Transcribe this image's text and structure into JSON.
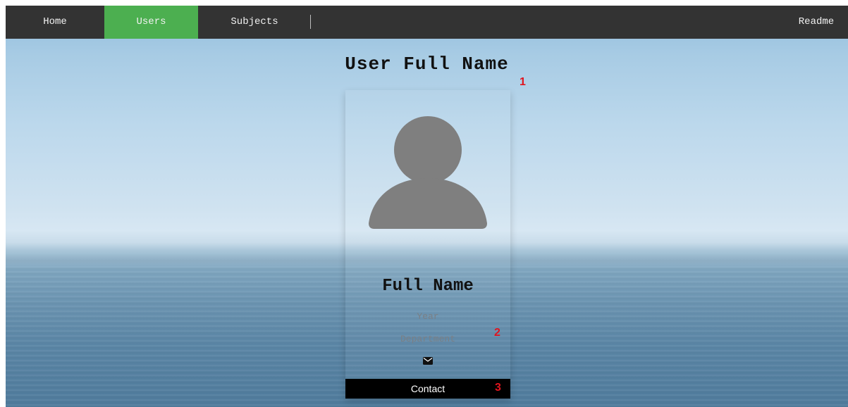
{
  "nav": {
    "home": "Home",
    "users": "Users",
    "subjects": "Subjects",
    "readme": "Readme",
    "active_color": "#4caf50",
    "bar_color": "#333333"
  },
  "page": {
    "title": "User Full Name"
  },
  "card": {
    "avatar_icon": "user-avatar-icon",
    "name": "Full Name",
    "year": "Year",
    "department": "Department",
    "mail_icon": "envelope-icon",
    "contact_label": "Contact"
  },
  "annotations": {
    "marker_1": "1",
    "marker_2": "2",
    "marker_3": "3",
    "color": "#e0141e"
  }
}
